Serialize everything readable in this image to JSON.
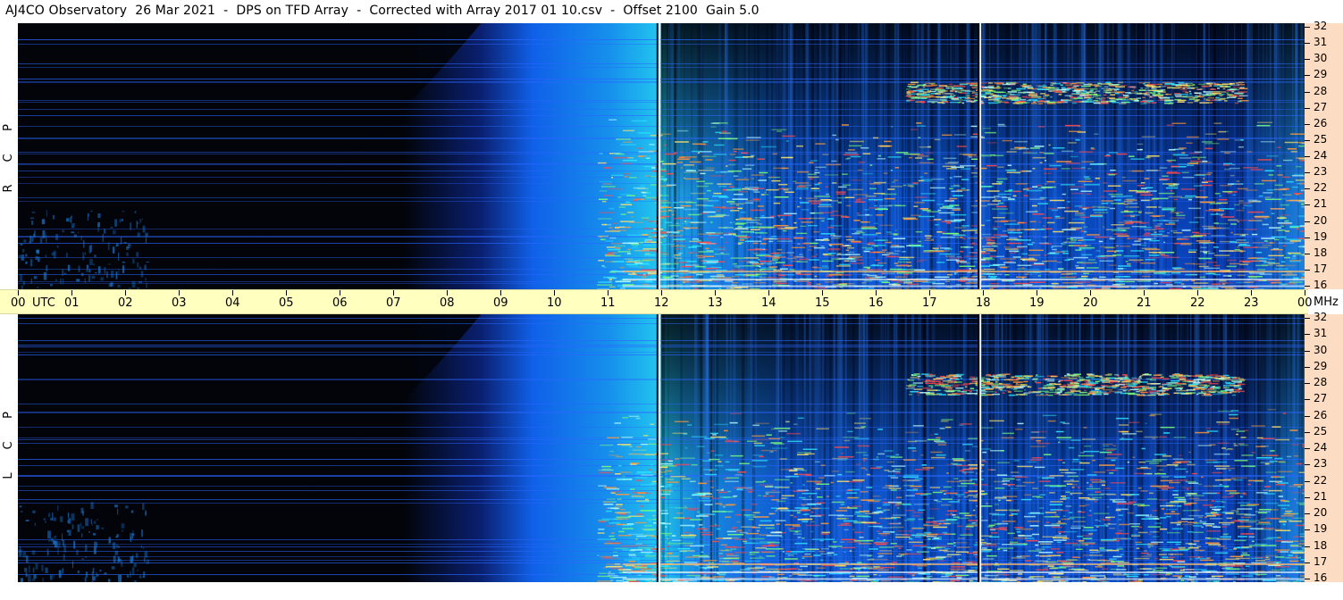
{
  "title": "AJ4CO Observatory  26 Mar 2021  -  DPS on TFD Array  -  Corrected with Array 2017 01 10.csv  -  Offset 2100  Gain 5.0",
  "chart_data": [
    {
      "type": "heatmap",
      "panel_label": [
        "R",
        "C",
        "P"
      ],
      "x_ticks": [
        "00",
        "UTC",
        "01",
        "02",
        "03",
        "04",
        "05",
        "06",
        "07",
        "08",
        "09",
        "10",
        "11",
        "12",
        "13",
        "14",
        "15",
        "16",
        "17",
        "18",
        "19",
        "20",
        "21",
        "22",
        "23",
        "00"
      ],
      "x_unit_label": "UTC",
      "xlim_hours": [
        0,
        24
      ],
      "y_ticks": [
        "16",
        "17",
        "18",
        "19",
        "20",
        "21",
        "22",
        "23",
        "24",
        "25",
        "26",
        "27",
        "28",
        "29",
        "30",
        "31",
        "32"
      ],
      "ylim_mhz": [
        16,
        32
      ],
      "y_unit_label": "MHz"
    },
    {
      "type": "heatmap",
      "panel_label": [
        "L",
        "C",
        "P"
      ],
      "x_ticks": [
        "00",
        "UTC",
        "01",
        "02",
        "03",
        "04",
        "05",
        "06",
        "07",
        "08",
        "09",
        "10",
        "11",
        "12",
        "13",
        "14",
        "15",
        "16",
        "17",
        "18",
        "19",
        "20",
        "21",
        "22",
        "23",
        "00"
      ],
      "xlim_hours": [
        0,
        24
      ],
      "y_ticks": [
        "16",
        "17",
        "18",
        "19",
        "20",
        "21",
        "22",
        "23",
        "24",
        "25",
        "26",
        "27",
        "28",
        "29",
        "30",
        "31",
        "32"
      ],
      "ylim_mhz": [
        16,
        32
      ]
    }
  ],
  "time_axis": {
    "ticks": [
      "00",
      "01",
      "02",
      "03",
      "04",
      "05",
      "06",
      "07",
      "08",
      "09",
      "10",
      "11",
      "12",
      "13",
      "14",
      "15",
      "16",
      "17",
      "18",
      "19",
      "20",
      "21",
      "22",
      "23",
      "00"
    ],
    "utc_label": "UTC",
    "mhz_label": "MHz"
  },
  "freq_axis": {
    "labels": [
      "32",
      "31",
      "30",
      "29",
      "28",
      "27",
      "26",
      "25",
      "24",
      "23",
      "22",
      "21",
      "20",
      "19",
      "18",
      "17",
      "16"
    ]
  },
  "pol": {
    "rcp": [
      "R",
      "C",
      "P"
    ],
    "lcp": [
      "L",
      "C",
      "P"
    ]
  },
  "colors": {
    "night": "#02040a",
    "day_blue": "#1060e8",
    "noon_cyan": "#22c8f0",
    "axis_time_bg": "#ffffbf",
    "axis_freq_bg": "#fcdcc2"
  },
  "features": {
    "calibration_lines_utc": [
      11.93,
      17.92
    ],
    "sunrise_utc": 7.5,
    "sunset_utc": 23.8
  }
}
